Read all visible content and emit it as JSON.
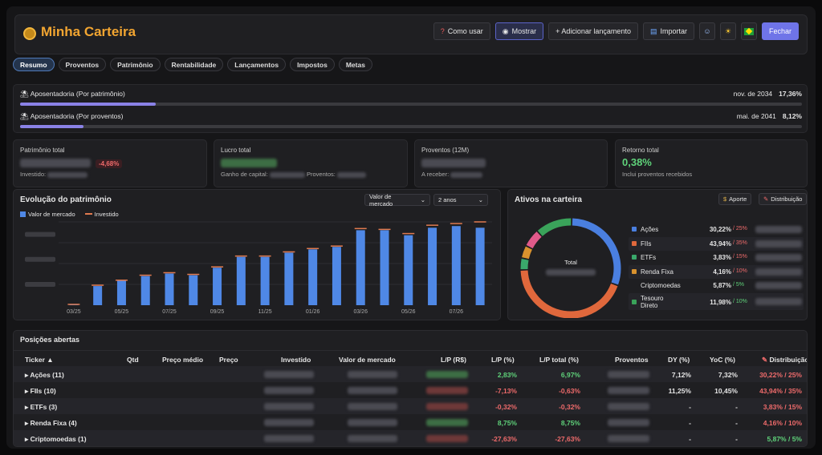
{
  "header": {
    "title": "Minha Carteira",
    "buttons": {
      "como_usar": "Como usar",
      "mostrar": "Mostrar",
      "adicionar": "+ Adicionar lançamento",
      "importar": "Importar",
      "fechar": "Fechar"
    },
    "icons": [
      "question-icon",
      "eye-icon",
      "import-icon",
      "user-icon",
      "sun-icon",
      "brazil-flag-icon"
    ]
  },
  "tabs": [
    "Resumo",
    "Proventos",
    "Patrimônio",
    "Rentabilidade",
    "Lançamentos",
    "Impostos",
    "Metas"
  ],
  "active_tab": 0,
  "goals": [
    {
      "label": "Aposentadoria (Por patrimônio)",
      "date": "nov. de 2034",
      "percent_text": "17,36%",
      "progress": 0.1736
    },
    {
      "label": "Aposentadoria (Por proventos)",
      "date": "mai. de 2041",
      "percent_text": "8,12%",
      "progress": 0.0812
    }
  ],
  "kpis": {
    "patrimonio": {
      "label": "Patrimônio total",
      "change": "-4,68%",
      "sub_label": "Investido:"
    },
    "lucro": {
      "label": "Lucro total",
      "sub_label": "Ganho de capital:",
      "sub_label2": "Proventos:"
    },
    "proventos": {
      "label": "Proventos (12M)",
      "sub_label": "A receber:"
    },
    "retorno": {
      "label": "Retorno total",
      "value": "0,38%",
      "sub_label": "Inclui proventos recebidos"
    }
  },
  "evolucao": {
    "title": "Evolução do patrimônio",
    "select_metric": "Valor de mercado",
    "select_period": "2 anos",
    "legend": {
      "valor": "Valor de mercado",
      "investido": "Investido"
    }
  },
  "chart_data": {
    "type": "bar",
    "categories": [
      "03/25",
      "04/25",
      "05/25",
      "06/25",
      "07/25",
      "08/25",
      "09/25",
      "10/25",
      "11/25",
      "12/25",
      "01/26",
      "02/26",
      "03/26",
      "04/26",
      "05/26",
      "06/26",
      "07/26",
      "08/26"
    ],
    "x_tick_labels": [
      "03/25",
      "05/25",
      "07/25",
      "09/25",
      "11/25",
      "01/26",
      "03/26",
      "05/26",
      "07/26"
    ],
    "series": [
      {
        "name": "Valor de mercado",
        "type": "bar",
        "values": [
          1,
          23,
          30,
          35,
          38,
          36,
          45,
          58,
          58,
          63,
          67,
          70,
          90,
          90,
          84,
          93,
          95,
          93
        ]
      },
      {
        "name": "Investido",
        "type": "marker",
        "values": [
          1,
          24,
          30,
          36,
          39,
          37,
          46,
          59,
          59,
          64,
          68,
          71,
          92,
          91,
          86,
          96,
          98,
          100
        ]
      }
    ],
    "ylim": [
      0,
      100
    ]
  },
  "ativos": {
    "title": "Ativos na carteira",
    "aporte": "Aporte",
    "distribuicao": "Distribuição",
    "total_label": "Total",
    "items": [
      {
        "name": "Ações",
        "percent": "30,22%",
        "meta": "/ 25%",
        "value": 30.22,
        "color": "#4a7fe0",
        "meta_color": "#ef6b6b"
      },
      {
        "name": "FIIs",
        "percent": "43,94%",
        "meta": "/ 35%",
        "value": 43.94,
        "color": "#e0683c",
        "meta_color": "#ef6b6b"
      },
      {
        "name": "ETFs",
        "percent": "3,83%",
        "meta": "/ 15%",
        "value": 3.83,
        "color": "#3aa86b",
        "meta_color": "#ef6b6b"
      },
      {
        "name": "Renda Fixa",
        "percent": "4,16%",
        "meta": "/ 10%",
        "value": 4.16,
        "color": "#d9922e",
        "meta_color": "#ef6b6b"
      },
      {
        "name": "Criptomoedas",
        "percent": "5,87%",
        "meta": "/ 5%",
        "value": 5.87,
        "color": "#e05a8a",
        "meta_color": "#5fd27a"
      },
      {
        "name": "Tesouro Direto",
        "percent": "11,98%",
        "meta": "/ 10%",
        "value": 11.98,
        "color": "#3aa35a",
        "meta_color": "#5fd27a"
      }
    ]
  },
  "positions": {
    "title": "Posições abertas",
    "columns": [
      "Ticker ▲",
      "Qtd",
      "Preço médio",
      "Preço",
      "Investido",
      "Valor de mercado",
      "L/P (R$)",
      "L/P (%)",
      "L/P total (%)",
      "Proventos",
      "DY (%)",
      "YoC (%)",
      "Distribuição"
    ],
    "rows": [
      {
        "ticker": "▸ Ações (11)",
        "lp_sign": "pos",
        "lp_pct": "2,83%",
        "lp_total": "6,97%",
        "dy": "7,12%",
        "yoc": "7,32%",
        "dist": "30,22% / 25%",
        "dist_ok": false
      },
      {
        "ticker": "▸ FIIs (10)",
        "lp_sign": "neg",
        "lp_pct": "-7,13%",
        "lp_total": "-0,63%",
        "dy": "11,25%",
        "yoc": "10,45%",
        "dist": "43,94% / 35%",
        "dist_ok": false
      },
      {
        "ticker": "▸ ETFs (3)",
        "lp_sign": "neg",
        "lp_pct": "-0,32%",
        "lp_total": "-0,32%",
        "dy": "-",
        "yoc": "-",
        "dist": "3,83% / 15%",
        "dist_ok": false
      },
      {
        "ticker": "▸ Renda Fixa (4)",
        "lp_sign": "pos",
        "lp_pct": "8,75%",
        "lp_total": "8,75%",
        "dy": "-",
        "yoc": "-",
        "dist": "4,16% / 10%",
        "dist_ok": false
      },
      {
        "ticker": "▸ Criptomoedas (1)",
        "lp_sign": "neg",
        "lp_pct": "-27,63%",
        "lp_total": "-27,63%",
        "dy": "-",
        "yoc": "-",
        "dist": "5,87% / 5%",
        "dist_ok": true
      }
    ]
  }
}
